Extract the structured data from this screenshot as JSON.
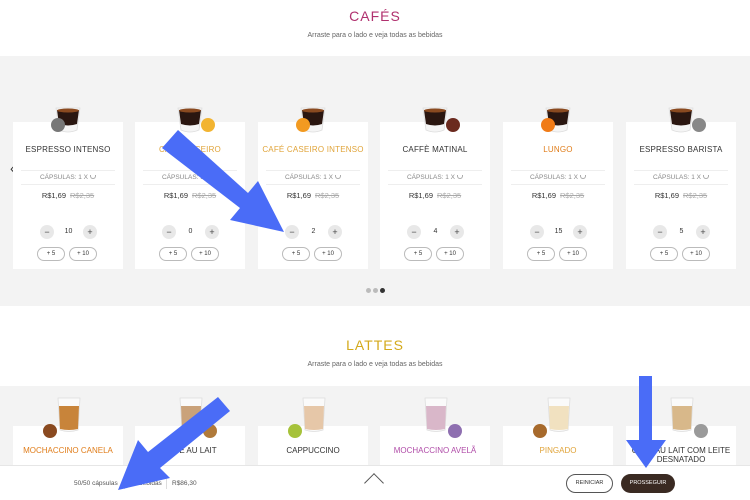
{
  "colors": {
    "cafes_title": "#b0306e",
    "lattes_title": "#d4aa1c",
    "band_bg": "#f3f3f3",
    "prosseguir_bg": "#3a2a22",
    "annotation_arrow": "#4a6cf7"
  },
  "cafes": {
    "title": "CAFÉS",
    "subtitle": "Arraste para o lado e veja todas as bebidas",
    "prev_icon": "chevron-left-icon",
    "next_icon": "chevron-right-icon",
    "prev_glyph": "‹",
    "next_glyph": "›",
    "cards": [
      {
        "name": "ESPRESSO INTENSO",
        "name_color": "#333333",
        "capsules": "CÁPSULAS: 1 X",
        "price": "R$1,69",
        "old_price": "R$2,35",
        "qty": "10",
        "minus": "−",
        "plus": "+",
        "add5": "+ 5",
        "add10": "+ 10",
        "dot_color": "#777777"
      },
      {
        "name": "CAFÉ CASEIRO",
        "name_color": "#e0a43a",
        "capsules": "CÁPSULAS: 1 X",
        "price": "R$1,69",
        "old_price": "R$2,35",
        "qty": "0",
        "minus": "−",
        "plus": "+",
        "add5": "+ 5",
        "add10": "+ 10",
        "dot_color": "#f2b431"
      },
      {
        "name": "CAFÉ CASEIRO INTENSO",
        "name_color": "#e0a43a",
        "capsules": "CÁPSULAS: 1 X",
        "price": "R$1,69",
        "old_price": "R$2,35",
        "qty": "2",
        "minus": "−",
        "plus": "+",
        "add5": "+ 5",
        "add10": "+ 10",
        "dot_color": "#f29a21"
      },
      {
        "name": "CAFFÈ MATINAL",
        "name_color": "#333333",
        "capsules": "CÁPSULAS: 1 X",
        "price": "R$1,69",
        "old_price": "R$2,35",
        "qty": "4",
        "minus": "−",
        "plus": "+",
        "add5": "+ 5",
        "add10": "+ 10",
        "dot_color": "#6b2a1e"
      },
      {
        "name": "LUNGO",
        "name_color": "#e07d1a",
        "capsules": "CÁPSULAS: 1 X",
        "price": "R$1,69",
        "old_price": "R$2,35",
        "qty": "15",
        "minus": "−",
        "plus": "+",
        "add5": "+ 5",
        "add10": "+ 10",
        "dot_color": "#f07b17"
      },
      {
        "name": "ESPRESSO BARISTA",
        "name_color": "#333333",
        "capsules": "CÁPSULAS: 1 X",
        "price": "R$1,69",
        "old_price": "R$2,35",
        "qty": "5",
        "minus": "−",
        "plus": "+",
        "add5": "+ 5",
        "add10": "+ 10",
        "dot_color": "#888888"
      }
    ],
    "pager": {
      "count": 3,
      "active_index": 2
    }
  },
  "lattes": {
    "title": "LATTES",
    "subtitle": "Arraste para o lado e veja todas as bebidas",
    "cards": [
      {
        "name": "MOCHACCINO CANELA",
        "name_color": "#e07d1a"
      },
      {
        "name": "CAFÉ AU LAIT",
        "name_color": "#333333"
      },
      {
        "name": "CAPPUCCINO",
        "name_color": "#333333"
      },
      {
        "name": "MOCHACCINO AVELÃ",
        "name_color": "#b04ca8"
      },
      {
        "name": "PINGADO",
        "name_color": "#e0a43a"
      },
      {
        "name": "CAFÉ AU LAIT COM LEITE DESNATADO",
        "name_color": "#333333"
      }
    ]
  },
  "summary": {
    "capsules": "50/50 cápsulas",
    "drinks": "50 bebidas",
    "total": "R$86,30",
    "expand_icon": "chevron-up-icon",
    "reset_label": "REINICIAR",
    "proceed_label": "PROSSEGUIR"
  }
}
